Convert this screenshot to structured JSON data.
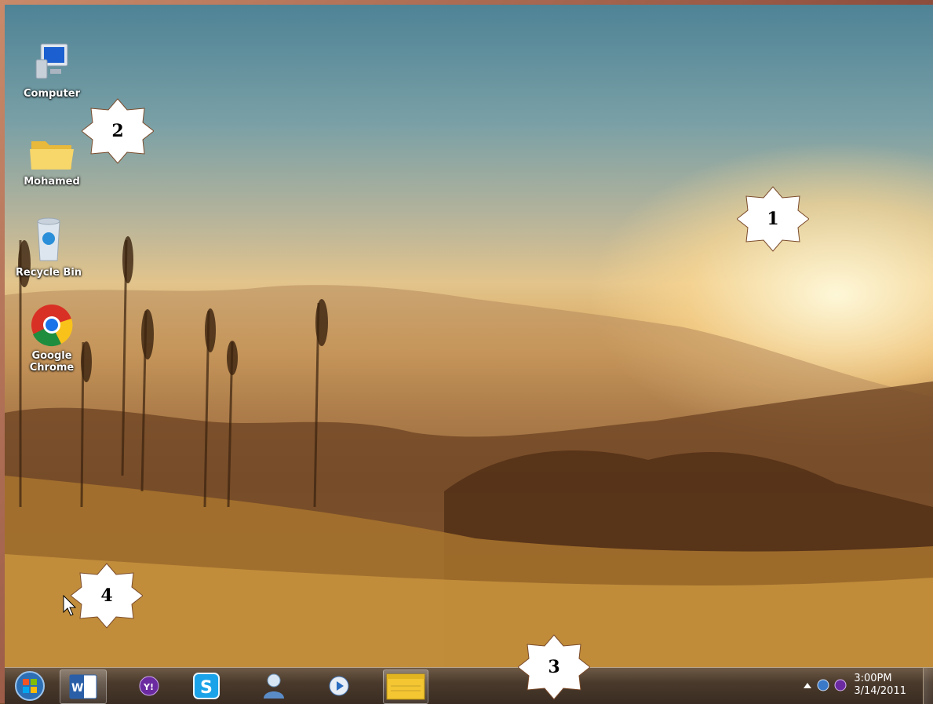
{
  "desktop": {
    "icons": [
      {
        "label": "Computer",
        "icon": "computer-icon"
      },
      {
        "label": "Mohamed",
        "icon": "folder-icon"
      },
      {
        "label": "Recycle Bin",
        "icon": "recycle-bin-icon"
      },
      {
        "label_line1": "Google",
        "label_line2": "Chrome",
        "icon": "chrome-icon"
      }
    ]
  },
  "callouts": [
    "1",
    "2",
    "3",
    "4"
  ],
  "taskbar": {
    "items": [
      {
        "name": "start-button",
        "icon": "windows-orb-icon"
      },
      {
        "name": "word",
        "icon": "word-icon"
      },
      {
        "name": "yahoo-messenger",
        "icon": "yahoo-icon"
      },
      {
        "name": "skype",
        "icon": "skype-icon"
      },
      {
        "name": "contacts",
        "icon": "user-icon"
      },
      {
        "name": "media-player",
        "icon": "media-player-icon"
      },
      {
        "name": "sticky-notes",
        "icon": "sticky-notes-icon"
      }
    ],
    "tray_icons": [
      "show-hidden-icons-icon",
      "network-icon",
      "messenger-tray-icon"
    ],
    "clock": {
      "time": "3:00PM",
      "date": "3/14/2011"
    }
  },
  "colors": {
    "accent": "#3a2c22",
    "sky": "#4e8396",
    "sun": "#fff7d8"
  }
}
